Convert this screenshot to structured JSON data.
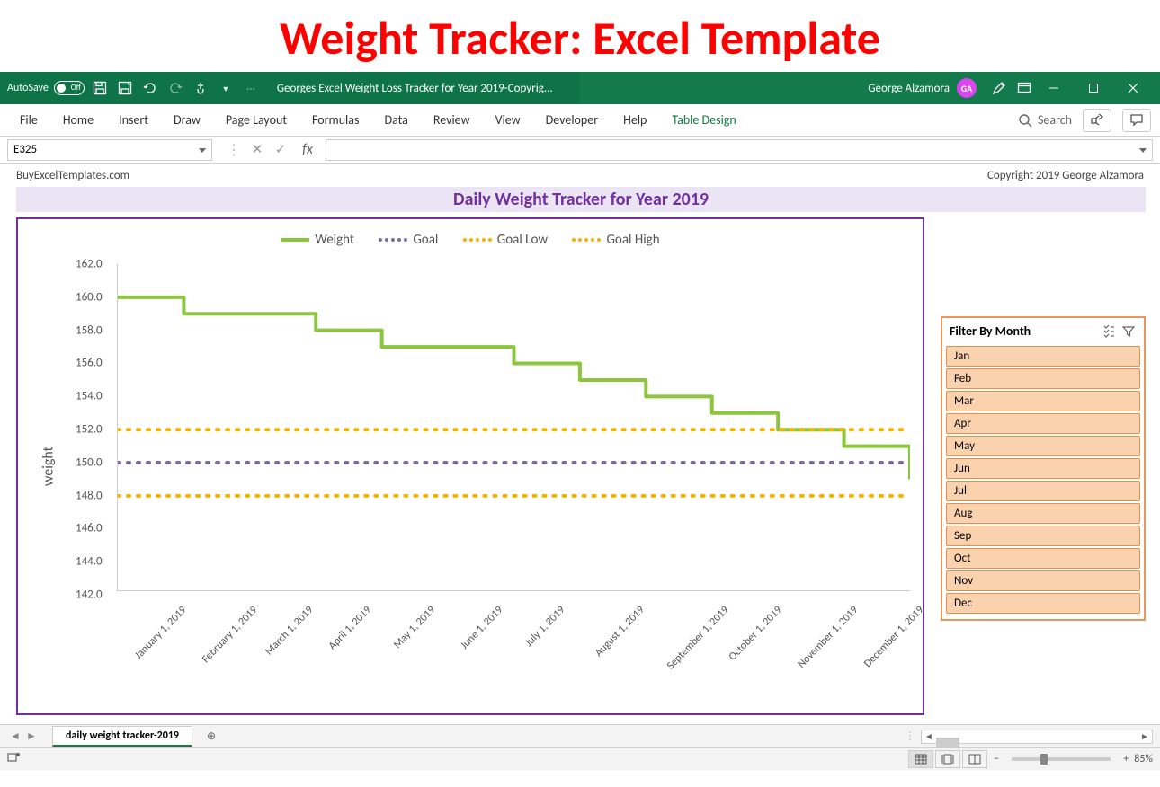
{
  "banner": "Weight Tracker: Excel Template",
  "titlebar": {
    "autosave_label": "AutoSave",
    "autosave_state": "Off",
    "doc_title": "Georges Excel Weight Loss Tracker for Year 2019-Copyrig...",
    "user_name": "George Alzamora",
    "user_initials": "GA"
  },
  "ribbon": {
    "tabs": [
      "File",
      "Home",
      "Insert",
      "Draw",
      "Page Layout",
      "Formulas",
      "Data",
      "Review",
      "View",
      "Developer",
      "Help",
      "Table Design"
    ],
    "active_tab": "Table Design",
    "search_placeholder": "Search"
  },
  "namebox": "E325",
  "sheet": {
    "site": "BuyExcelTemplates.com",
    "copyright": "Copyright 2019  George Alzamora",
    "chart_title": "Daily Weight Tracker for Year 2019",
    "ylabel": "weight",
    "legend": [
      "Weight",
      "Goal",
      "Goal Low",
      "Goal High"
    ]
  },
  "slicer": {
    "title": "Filter By Month",
    "items": [
      "Jan",
      "Feb",
      "Mar",
      "Apr",
      "May",
      "Jun",
      "Jul",
      "Aug",
      "Sep",
      "Oct",
      "Nov",
      "Dec"
    ]
  },
  "sheet_tabs": {
    "active": "daily weight tracker-2019"
  },
  "statusbar": {
    "zoom": "85%"
  },
  "chart_data": {
    "type": "line",
    "title": "Daily Weight Tracker for Year 2019",
    "ylabel": "weight",
    "xlabel": "",
    "ylim": [
      142,
      162
    ],
    "y_ticks": [
      142.0,
      144.0,
      146.0,
      148.0,
      150.0,
      152.0,
      154.0,
      156.0,
      158.0,
      160.0,
      162.0
    ],
    "x_tick_labels": [
      "January 1, 2019",
      "February 1, 2019",
      "March 1, 2019",
      "April 1, 2019",
      "May 1, 2019",
      "June 1, 2019",
      "July 1, 2019",
      "August 1, 2019",
      "September 1, 2019",
      "October 1, 2019",
      "November 1, 2019",
      "December 1, 2019"
    ],
    "series": [
      {
        "name": "Weight",
        "style": "solid",
        "color": "#8cc63f",
        "x": [
          0,
          0.5,
          1,
          1.5,
          2,
          2.5,
          3,
          3.5,
          4,
          4.5,
          5,
          5.5,
          6,
          6.5,
          7,
          7.5,
          8,
          8.5,
          9,
          9.5,
          10,
          10.5,
          11,
          11.5,
          12
        ],
        "values": [
          160,
          160,
          159,
          159,
          159,
          159,
          158,
          158,
          157,
          157,
          157,
          157,
          156,
          156,
          155,
          155,
          154,
          154,
          153,
          153,
          152,
          152,
          151,
          151,
          150
        ]
      },
      {
        "name": "Goal",
        "style": "dotted",
        "color": "#7c6aa6",
        "constant": 150
      },
      {
        "name": "Goal Low",
        "style": "dotted",
        "color": "#f0b400",
        "constant": 148
      },
      {
        "name": "Goal High",
        "style": "dotted",
        "color": "#f0b400",
        "constant": 152
      }
    ],
    "legend": [
      "Weight",
      "Goal",
      "Goal Low",
      "Goal High"
    ]
  }
}
